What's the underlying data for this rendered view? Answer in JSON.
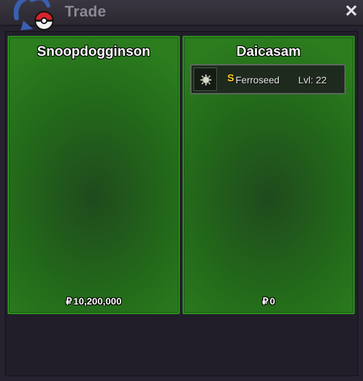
{
  "window": {
    "title": "Trade",
    "close_glyph": "✕"
  },
  "left_player": {
    "name": "Snoopdogginson",
    "currency_symbol": "₽",
    "money": "10,200,000"
  },
  "right_player": {
    "name": "Daicasam",
    "currency_symbol": "₽",
    "money": "0",
    "items": [
      {
        "icon": "ferroseed-icon",
        "badge": "S",
        "name": "Ferroseed",
        "level": "Lvl: 22"
      }
    ]
  },
  "colors": {
    "panel_green": "#236a1a",
    "panel_border": "#2f8f1e",
    "badge_gold": "#ffcc22",
    "window_bg": "#26222f"
  }
}
